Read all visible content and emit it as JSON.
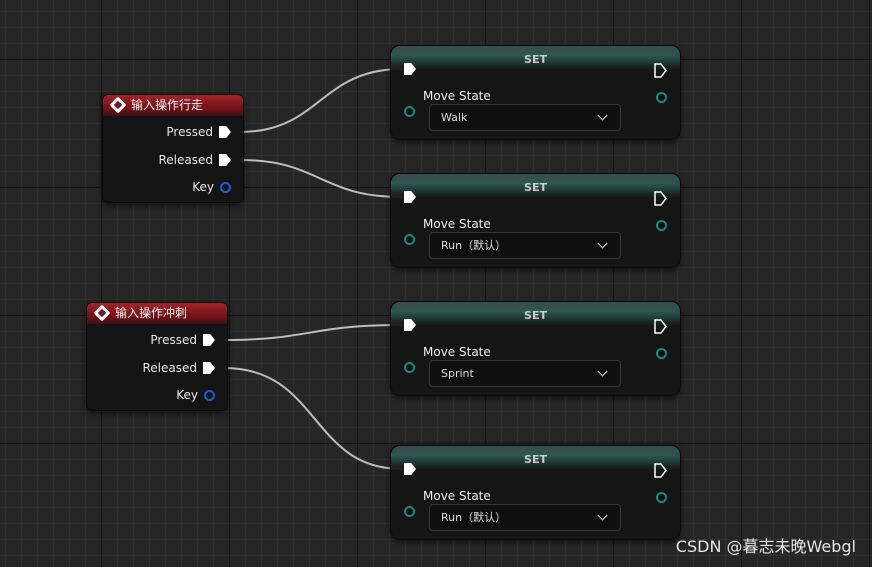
{
  "events": [
    {
      "title": "输入操作行走",
      "pins": {
        "pressed": "Pressed",
        "released": "Released",
        "key": "Key"
      }
    },
    {
      "title": "输入操作冲刺",
      "pins": {
        "pressed": "Pressed",
        "released": "Released",
        "key": "Key"
      }
    }
  ],
  "set_nodes": [
    {
      "title": "SET",
      "variable": "Move State",
      "value": "Walk"
    },
    {
      "title": "SET",
      "variable": "Move State",
      "value": "Run（默认）"
    },
    {
      "title": "SET",
      "variable": "Move State",
      "value": "Sprint"
    },
    {
      "title": "SET",
      "variable": "Move State",
      "value": "Run（默认）"
    }
  ],
  "colors": {
    "event_header": "#a3232a",
    "set_header": "#2c5653",
    "key_pin": "#1a5ad6",
    "variable_pin": "#0f8f80",
    "wire": "#bdbdbd"
  },
  "watermark": "CSDN @暮志未晚Webgl"
}
